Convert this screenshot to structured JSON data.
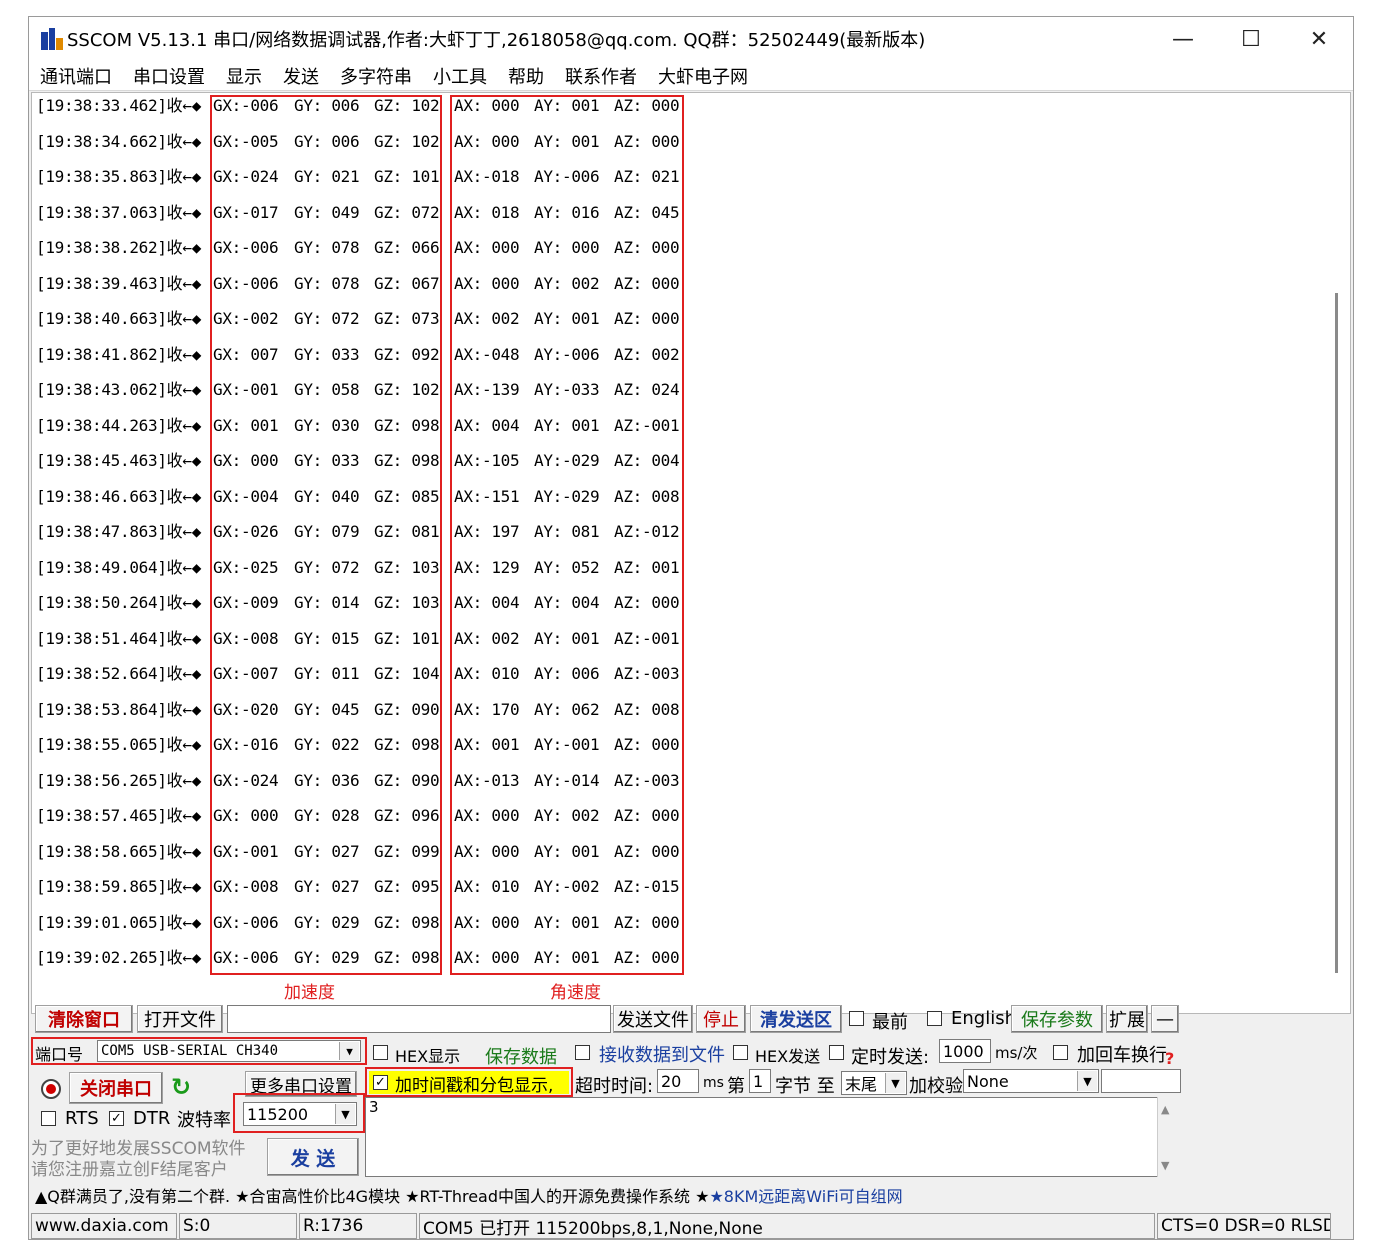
{
  "window": {
    "title": "SSCOM V5.13.1 串口/网络数据调试器,作者:大虾丁丁,2618058@qq.com. QQ群：52502449(最新版本)",
    "minimize": "—",
    "maximize": "☐",
    "close": "✕"
  },
  "menu": [
    "通讯端口",
    "串口设置",
    "显示",
    "发送",
    "多字符串",
    "小工具",
    "帮助",
    "联系作者",
    "大虾电子网"
  ],
  "log": [
    {
      "ts": "[19:38:33.462]收←◆",
      "gx": "GX:-006",
      "gy": "GY: 006",
      "gz": "GZ: 102",
      "ax": "AX: 000",
      "ay": "AY: 001",
      "az": "AZ: 000"
    },
    {
      "ts": "[19:38:34.662]收←◆",
      "gx": "GX:-005",
      "gy": "GY: 006",
      "gz": "GZ: 102",
      "ax": "AX: 000",
      "ay": "AY: 001",
      "az": "AZ: 000"
    },
    {
      "ts": "[19:38:35.863]收←◆",
      "gx": "GX:-024",
      "gy": "GY: 021",
      "gz": "GZ: 101",
      "ax": "AX:-018",
      "ay": "AY:-006",
      "az": "AZ: 021"
    },
    {
      "ts": "[19:38:37.063]收←◆",
      "gx": "GX:-017",
      "gy": "GY: 049",
      "gz": "GZ: 072",
      "ax": "AX: 018",
      "ay": "AY: 016",
      "az": "AZ: 045"
    },
    {
      "ts": "[19:38:38.262]收←◆",
      "gx": "GX:-006",
      "gy": "GY: 078",
      "gz": "GZ: 066",
      "ax": "AX: 000",
      "ay": "AY: 000",
      "az": "AZ: 000"
    },
    {
      "ts": "[19:38:39.463]收←◆",
      "gx": "GX:-006",
      "gy": "GY: 078",
      "gz": "GZ: 067",
      "ax": "AX: 000",
      "ay": "AY: 002",
      "az": "AZ: 000"
    },
    {
      "ts": "[19:38:40.663]收←◆",
      "gx": "GX:-002",
      "gy": "GY: 072",
      "gz": "GZ: 073",
      "ax": "AX: 002",
      "ay": "AY: 001",
      "az": "AZ: 000"
    },
    {
      "ts": "[19:38:41.862]收←◆",
      "gx": "GX: 007",
      "gy": "GY: 033",
      "gz": "GZ: 092",
      "ax": "AX:-048",
      "ay": "AY:-006",
      "az": "AZ: 002"
    },
    {
      "ts": "[19:38:43.062]收←◆",
      "gx": "GX:-001",
      "gy": "GY: 058",
      "gz": "GZ: 102",
      "ax": "AX:-139",
      "ay": "AY:-033",
      "az": "AZ: 024"
    },
    {
      "ts": "[19:38:44.263]收←◆",
      "gx": "GX: 001",
      "gy": "GY: 030",
      "gz": "GZ: 098",
      "ax": "AX: 004",
      "ay": "AY: 001",
      "az": "AZ:-001"
    },
    {
      "ts": "[19:38:45.463]收←◆",
      "gx": "GX: 000",
      "gy": "GY: 033",
      "gz": "GZ: 098",
      "ax": "AX:-105",
      "ay": "AY:-029",
      "az": "AZ: 004"
    },
    {
      "ts": "[19:38:46.663]收←◆",
      "gx": "GX:-004",
      "gy": "GY: 040",
      "gz": "GZ: 085",
      "ax": "AX:-151",
      "ay": "AY:-029",
      "az": "AZ: 008"
    },
    {
      "ts": "[19:38:47.863]收←◆",
      "gx": "GX:-026",
      "gy": "GY: 079",
      "gz": "GZ: 081",
      "ax": "AX: 197",
      "ay": "AY: 081",
      "az": "AZ:-012"
    },
    {
      "ts": "[19:38:49.064]收←◆",
      "gx": "GX:-025",
      "gy": "GY: 072",
      "gz": "GZ: 103",
      "ax": "AX: 129",
      "ay": "AY: 052",
      "az": "AZ: 001"
    },
    {
      "ts": "[19:38:50.264]收←◆",
      "gx": "GX:-009",
      "gy": "GY: 014",
      "gz": "GZ: 103",
      "ax": "AX: 004",
      "ay": "AY: 004",
      "az": "AZ: 000"
    },
    {
      "ts": "[19:38:51.464]收←◆",
      "gx": "GX:-008",
      "gy": "GY: 015",
      "gz": "GZ: 101",
      "ax": "AX: 002",
      "ay": "AY: 001",
      "az": "AZ:-001"
    },
    {
      "ts": "[19:38:52.664]收←◆",
      "gx": "GX:-007",
      "gy": "GY: 011",
      "gz": "GZ: 104",
      "ax": "AX: 010",
      "ay": "AY: 006",
      "az": "AZ:-003"
    },
    {
      "ts": "[19:38:53.864]收←◆",
      "gx": "GX:-020",
      "gy": "GY: 045",
      "gz": "GZ: 090",
      "ax": "AX: 170",
      "ay": "AY: 062",
      "az": "AZ: 008"
    },
    {
      "ts": "[19:38:55.065]收←◆",
      "gx": "GX:-016",
      "gy": "GY: 022",
      "gz": "GZ: 098",
      "ax": "AX: 001",
      "ay": "AY:-001",
      "az": "AZ: 000"
    },
    {
      "ts": "[19:38:56.265]收←◆",
      "gx": "GX:-024",
      "gy": "GY: 036",
      "gz": "GZ: 090",
      "ax": "AX:-013",
      "ay": "AY:-014",
      "az": "AZ:-003"
    },
    {
      "ts": "[19:38:57.465]收←◆",
      "gx": "GX: 000",
      "gy": "GY: 028",
      "gz": "GZ: 096",
      "ax": "AX: 000",
      "ay": "AY: 002",
      "az": "AZ: 000"
    },
    {
      "ts": "[19:38:58.665]收←◆",
      "gx": "GX:-001",
      "gy": "GY: 027",
      "gz": "GZ: 099",
      "ax": "AX: 000",
      "ay": "AY: 001",
      "az": "AZ: 000"
    },
    {
      "ts": "[19:38:59.865]收←◆",
      "gx": "GX:-008",
      "gy": "GY: 027",
      "gz": "GZ: 095",
      "ax": "AX: 010",
      "ay": "AY:-002",
      "az": "AZ:-015"
    },
    {
      "ts": "[19:39:01.065]收←◆",
      "gx": "GX:-006",
      "gy": "GY: 029",
      "gz": "GZ: 098",
      "ax": "AX: 000",
      "ay": "AY: 001",
      "az": "AZ: 000"
    },
    {
      "ts": "[19:39:02.265]收←◆",
      "gx": "GX:-006",
      "gy": "GY: 029",
      "gz": "GZ: 098",
      "ax": "AX: 000",
      "ay": "AY: 001",
      "az": "AZ: 000"
    }
  ],
  "annotations": {
    "accel_label": "加速度",
    "angular_label": "角速度"
  },
  "toolbar": {
    "clear": "清除窗口",
    "open_file": "打开文件",
    "send_file": "发送文件",
    "stop": "停止",
    "clear_send": "清发送区",
    "topmost": "最前",
    "english": "English",
    "save_params": "保存参数",
    "expand": "扩展",
    "collapse": "—"
  },
  "port": {
    "label": "端口号",
    "value": "COM5 USB-SERIAL CH340",
    "hex_display": "HEX显示",
    "save_data": "保存数据",
    "recv_to_file": "接收数据到文件",
    "hex_send": "HEX发送",
    "timed_send": "定时发送:",
    "interval": "1000",
    "interval_unit": "ms/次",
    "crlf": "加回车换行",
    "help": "?",
    "close_port": "关闭串口",
    "more_settings": "更多串口设置",
    "timestamp": "加时间戳和分包显示,",
    "timeout_label": "超时时间:",
    "timeout": "20",
    "timeout_unit": "ms",
    "nth_label": "第",
    "nth": "1",
    "byte_to": "字节 至",
    "end": "末尾",
    "checksum_label": "加校验",
    "checksum": "None",
    "rts": "RTS",
    "dtr": "DTR",
    "baud_label": "波特率",
    "baud": "115200",
    "send_text": "3",
    "promo1": "为了更好地发展SSCOM软件",
    "promo2": "请您注册嘉立创F结尾客户",
    "send": "发 送"
  },
  "ticker": "▲Q群满员了,没有第二个群. ★合宙高性价比4G模块 ★RT-Thread中国人的开源免费操作系统 ★",
  "ticker_link": "★8KM远距离WiFi可自组网",
  "status": {
    "site": "www.daxia.com",
    "sent": "S:0",
    "recv": "R:1736",
    "port_state": "COM5 已打开  115200bps,8,1,None,None",
    "lines": "CTS=0 DSR=0 RLSD"
  },
  "colors": {
    "red": "#e02020",
    "blue": "#1a3fa0",
    "highlight": "#ffff00"
  }
}
